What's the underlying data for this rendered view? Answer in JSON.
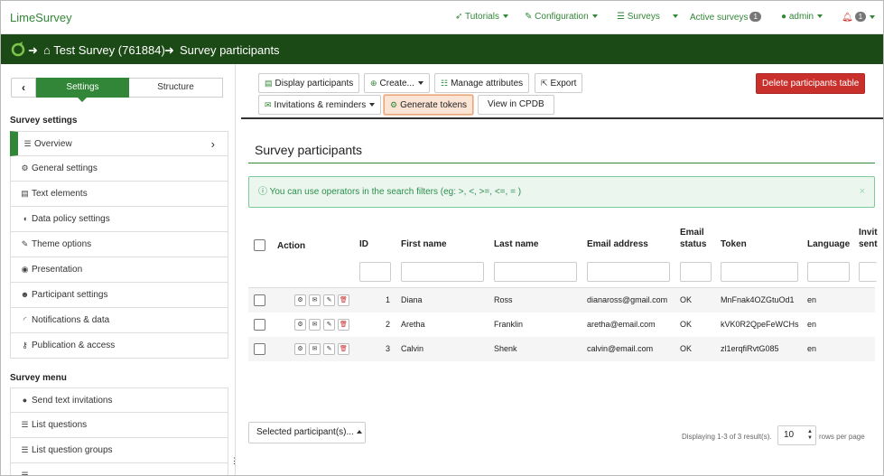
{
  "topnav": {
    "brand": "LimeSurvey",
    "tutorials": "Tutorials",
    "configuration": "Configuration",
    "surveys": "Surveys",
    "active_surveys": "Active surveys",
    "active_count": "1",
    "admin": "admin",
    "notif_count": "1"
  },
  "breadcrumb": {
    "survey": "Test Survey (761884)",
    "page": "Survey participants"
  },
  "sidebar": {
    "tab_settings": "Settings",
    "tab_structure": "Structure",
    "settings_title": "Survey settings",
    "settings_items": [
      {
        "label": "Overview",
        "icon": "list-icon"
      },
      {
        "label": "General settings",
        "icon": "gears-icon"
      },
      {
        "label": "Text elements",
        "icon": "document-icon"
      },
      {
        "label": "Data policy settings",
        "icon": "shield-icon"
      },
      {
        "label": "Theme options",
        "icon": "paintbrush-icon"
      },
      {
        "label": "Presentation",
        "icon": "eye-icon"
      },
      {
        "label": "Participant settings",
        "icon": "users-icon"
      },
      {
        "label": "Notifications & data",
        "icon": "rss-icon"
      },
      {
        "label": "Publication & access",
        "icon": "key-icon"
      }
    ],
    "menu_title": "Survey menu",
    "menu_items": [
      {
        "label": "Send text invitations",
        "icon": "comment-icon"
      },
      {
        "label": "List questions",
        "icon": "list-icon"
      },
      {
        "label": "List question groups",
        "icon": "list-icon"
      }
    ]
  },
  "toolbar": {
    "display": "Display participants",
    "create": "Create...",
    "manage": "Manage attributes",
    "export": "Export",
    "invitations": "Invitations & reminders",
    "generate": "Generate tokens",
    "cpdb": "View in CPDB",
    "delete": "Delete participants table"
  },
  "main": {
    "title": "Survey participants",
    "alert": "You can use operators in the search filters (eg: >, <, >=, <=, = )",
    "alert_close": "×"
  },
  "table": {
    "headers": {
      "action": "Action",
      "id": "ID",
      "first_name": "First name",
      "last_name": "Last name",
      "email": "Email address",
      "email_status_1": "Email",
      "email_status_2": "status",
      "token": "Token",
      "language": "Language",
      "invite_1": "Invit",
      "invite_2": "sent"
    },
    "rows": [
      {
        "id": "1",
        "first": "Diana",
        "last": "Ross",
        "email": "dianaross@gmail.com",
        "status": "OK",
        "token": "MnFnak4OZGtuOd1",
        "lang": "en"
      },
      {
        "id": "2",
        "first": "Aretha",
        "last": "Franklin",
        "email": "aretha@email.com",
        "status": "OK",
        "token": "kVK0R2QpeFeWCHs",
        "lang": "en"
      },
      {
        "id": "3",
        "first": "Calvin",
        "last": "Shenk",
        "email": "calvin@email.com",
        "status": "OK",
        "token": "zl1erqfiRvtG085",
        "lang": "en"
      }
    ]
  },
  "footer": {
    "selected": "Selected participant(s)...",
    "displaying": "Displaying 1-3 of 3 result(s).",
    "rows_value": "10",
    "rows_label": "rows per page"
  },
  "colors": {
    "brand_green": "#328637",
    "header_dark": "#1c4a16",
    "danger": "#c9302c"
  }
}
